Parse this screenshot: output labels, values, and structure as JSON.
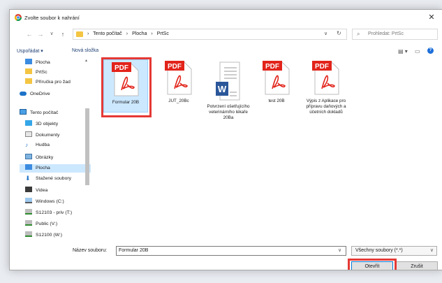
{
  "window": {
    "title": "Zvolte soubor k nahrání",
    "close_glyph": "✕"
  },
  "nav": {
    "back": "←",
    "forward": "→",
    "up": "↑",
    "breadcrumb": [
      "Tento počítač",
      "Plocha",
      "PrtSc"
    ],
    "separator": "›",
    "dropdown": "∨",
    "refresh": "↻",
    "search_placeholder": "Prohledat: PrtSc"
  },
  "toolbar": {
    "organize": "Uspořádat ▾",
    "new_folder": "Nová složka"
  },
  "sidebar": {
    "items": [
      {
        "label": "Plocha",
        "icon": "folder-blue-icon"
      },
      {
        "label": "PrtSc",
        "icon": "folder-icon"
      },
      {
        "label": "Příručka pro žad",
        "icon": "folder-icon"
      },
      {
        "label": "OneDrive",
        "icon": "cloud-icon"
      },
      {
        "label": "Tento počítač",
        "icon": "computer-icon"
      },
      {
        "label": "3D objekty",
        "icon": "cube-icon"
      },
      {
        "label": "Dokumenty",
        "icon": "documents-icon"
      },
      {
        "label": "Hudba",
        "icon": "music-icon"
      },
      {
        "label": "Obrázky",
        "icon": "pictures-icon"
      },
      {
        "label": "Plocha",
        "icon": "desktop-icon",
        "selected": true
      },
      {
        "label": "Stažené soubory",
        "icon": "download-icon"
      },
      {
        "label": "Videa",
        "icon": "video-icon"
      },
      {
        "label": "Windows (C:)",
        "icon": "drive-icon"
      },
      {
        "label": "S12103 - priv (T:)",
        "icon": "network-drive-icon"
      },
      {
        "label": "Public (V:)",
        "icon": "network-drive-icon"
      },
      {
        "label": "S12100 (W:)",
        "icon": "network-drive-icon"
      }
    ]
  },
  "files": [
    {
      "name": "Formular 20B",
      "type": "pdf",
      "badge": "PDF",
      "selected": true
    },
    {
      "name": "JUT_20Bc",
      "type": "pdf",
      "badge": "PDF"
    },
    {
      "name": "Potvrzení ošetřujícího veterinárního lékaře 20Ba",
      "type": "word",
      "badge": "W"
    },
    {
      "name": "test 20B",
      "type": "pdf",
      "badge": "PDF"
    },
    {
      "name": "Výpis z Aplikace pro přípravu daňových a účetních dokladů",
      "type": "pdf",
      "badge": "PDF"
    }
  ],
  "bottom": {
    "filename_label": "Název souboru:",
    "filename_value": "Formular 20B",
    "filetype": "Všechny soubory (*.*)",
    "open_button": "Otevřít",
    "cancel_button": "Zrušit"
  },
  "colors": {
    "pdf_red": "#e2231a",
    "word_blue": "#2b579a",
    "selection": "#cce8ff",
    "highlight": "#e53935"
  }
}
